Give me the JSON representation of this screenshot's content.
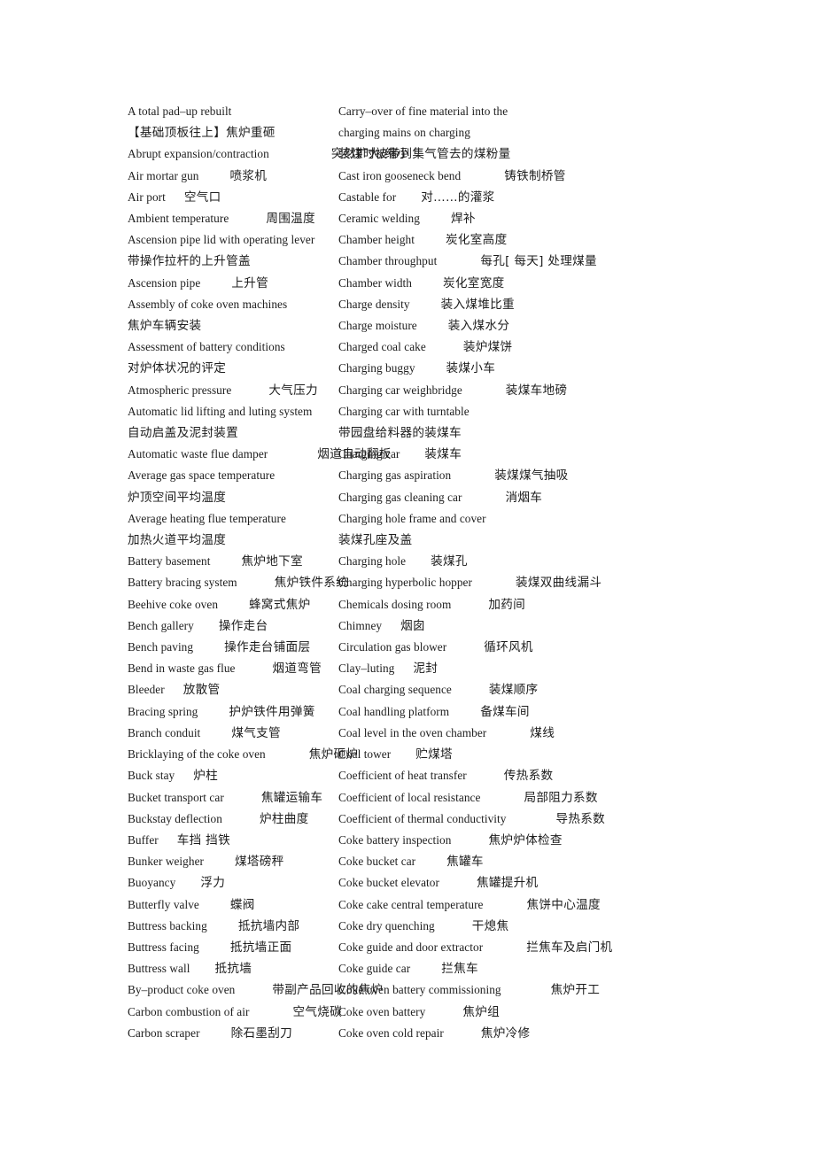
{
  "document": {
    "type": "bilingual-glossary",
    "subject": "Coke oven / coking plant terminology (English–Chinese)",
    "page_background": "#ffffff",
    "text_color": "#1d1d1d"
  },
  "columns": [
    {
      "name": "left-column",
      "entries": [
        {
          "en": "A total pad–up rebuilt",
          "zh": "",
          "gap": 0
        },
        {
          "en": "",
          "zh": "【基础顶板往上】焦炉重砸",
          "gap": 0
        },
        {
          "en": "Abrupt expansion/contraction",
          "zh": "突然扩大/缩小",
          "gap": 10
        },
        {
          "en": "Air mortar gun",
          "zh": "喷浆机",
          "gap": 5
        },
        {
          "en": "Air port",
          "zh": "空气口",
          "gap": 3
        },
        {
          "en": "Ambient temperature",
          "zh": "周围温度",
          "gap": 6
        },
        {
          "en": "Ascension pipe lid with operating lever",
          "zh": "",
          "gap": 0
        },
        {
          "en": "",
          "zh": "带操作拉杆的上升管盖",
          "gap": 0
        },
        {
          "en": "Ascension pipe",
          "zh": "上升管",
          "gap": 5
        },
        {
          "en": "Assembly of coke oven machines",
          "zh": "",
          "gap": 0
        },
        {
          "en": "",
          "zh": "焦炉车辆安装",
          "gap": 0
        },
        {
          "en": "Assessment of battery conditions",
          "zh": "",
          "gap": 0
        },
        {
          "en": "",
          "zh": "对炉体状况的评定",
          "gap": 0
        },
        {
          "en": "Atmospheric pressure",
          "zh": "大气压力",
          "gap": 6
        },
        {
          "en": "Automatic lid lifting and luting system",
          "zh": "",
          "gap": 0
        },
        {
          "en": "",
          "zh": "自动启盖及泥封装置",
          "gap": 0
        },
        {
          "en": "Automatic waste flue damper",
          "zh": "烟道自动翻板",
          "gap": 8
        },
        {
          "en": "Average gas space temperature",
          "zh": "",
          "gap": 0
        },
        {
          "en": "",
          "zh": "炉顶空间平均温度",
          "gap": 0
        },
        {
          "en": "Average heating flue temperature",
          "zh": "",
          "gap": 0
        },
        {
          "en": "",
          "zh": "加热火道平均温度",
          "gap": 0
        },
        {
          "en": "Battery basement",
          "zh": "焦炉地下室",
          "gap": 5
        },
        {
          "en": "Battery bracing system",
          "zh": "焦炉铁件系统",
          "gap": 6
        },
        {
          "en": "Beehive coke oven",
          "zh": "蜂窝式焦炉",
          "gap": 5
        },
        {
          "en": "Bench gallery",
          "zh": "操作走台",
          "gap": 4
        },
        {
          "en": "Bench paving",
          "zh": "操作走台铺面层",
          "gap": 5
        },
        {
          "en": "Bend in waste gas flue",
          "zh": "烟道弯管",
          "gap": 6
        },
        {
          "en": "Bleeder",
          "zh": "放散管",
          "gap": 3
        },
        {
          "en": "Bracing spring",
          "zh": "护炉铁件用弹簧",
          "gap": 5
        },
        {
          "en": "Branch conduit",
          "zh": "煤气支管",
          "gap": 5
        },
        {
          "en": "Bricklaying of the coke oven",
          "zh": "焦炉砸炉",
          "gap": 7
        },
        {
          "en": "Buck stay",
          "zh": "炉柱",
          "gap": 3
        },
        {
          "en": "Bucket transport car",
          "zh": "焦罐运输车",
          "gap": 6
        },
        {
          "en": "Buckstay deflection",
          "zh": "炉柱曲度",
          "gap": 6
        },
        {
          "en": "Buffer",
          "zh": "车挡 挡铁",
          "gap": 3
        },
        {
          "en": "Bunker weigher",
          "zh": "煤塔磅秤",
          "gap": 5
        },
        {
          "en": "Buoyancy",
          "zh": "浮力",
          "gap": 4
        },
        {
          "en": "Butterfly valve",
          "zh": "蝶阀",
          "gap": 5
        },
        {
          "en": "Buttress backing",
          "zh": "抵抗墙内部",
          "gap": 5
        },
        {
          "en": "Buttress facing",
          "zh": "抵抗墙正面",
          "gap": 5
        },
        {
          "en": "Buttress wall",
          "zh": "抵抗墙",
          "gap": 4
        },
        {
          "en": "By–product coke oven",
          "zh": "带副产品回收的焦炉",
          "gap": 6
        },
        {
          "en": "Carbon combustion of air",
          "zh": "空气烧碳",
          "gap": 7
        },
        {
          "en": "Carbon scraper",
          "zh": "除石墨刮刀",
          "gap": 5
        }
      ]
    },
    {
      "name": "right-column",
      "entries": [
        {
          "en": "Carry–over of fine material into the",
          "zh": "",
          "gap": 0
        },
        {
          "en": "charging mains on charging",
          "zh": "",
          "gap": 0
        },
        {
          "en": "",
          "zh": "装煤时被带到集气管去的煤粉量",
          "gap": 0
        },
        {
          "en": "Cast iron gooseneck bend",
          "zh": "铸铁制桥管",
          "gap": 7
        },
        {
          "en": "Castable for",
          "zh": "对……的灌浆",
          "gap": 4
        },
        {
          "en": "Ceramic welding",
          "zh": "焊补",
          "gap": 5
        },
        {
          "en": "Chamber height",
          "zh": "炭化室高度",
          "gap": 5
        },
        {
          "en": "Chamber throughput",
          "zh": "每孔[ 每天] 处理煤量",
          "gap": 7
        },
        {
          "en": "Chamber width",
          "zh": "炭化室宽度",
          "gap": 5
        },
        {
          "en": "Charge density",
          "zh": "装入煤堆比重",
          "gap": 5
        },
        {
          "en": "Charge moisture",
          "zh": "装入煤水分",
          "gap": 5
        },
        {
          "en": "Charged coal cake",
          "zh": "装炉煤饼",
          "gap": 6
        },
        {
          "en": "Charging buggy",
          "zh": "装煤小车",
          "gap": 5
        },
        {
          "en": "Charging car weighbridge",
          "zh": "装煤车地磅",
          "gap": 7
        },
        {
          "en": "Charging car with turntable",
          "zh": "",
          "gap": 0
        },
        {
          "en": "",
          "zh": "带园盘给料器的装煤车",
          "gap": 0
        },
        {
          "en": "Charging car",
          "zh": "装煤车",
          "gap": 4
        },
        {
          "en": "Charging gas aspiration",
          "zh": "装煤煤气抽吸",
          "gap": 7
        },
        {
          "en": "Charging gas cleaning car",
          "zh": "消烟车",
          "gap": 7
        },
        {
          "en": "Charging hole frame and cover",
          "zh": "",
          "gap": 0
        },
        {
          "en": "",
          "zh": "装煤孔座及盖",
          "gap": 0
        },
        {
          "en": "Charging hole",
          "zh": "装煤孔",
          "gap": 4
        },
        {
          "en": "Charging hyperbolic hopper",
          "zh": "装煤双曲线漏斗",
          "gap": 7
        },
        {
          "en": "Chemicals dosing room",
          "zh": "加药间",
          "gap": 6
        },
        {
          "en": "Chimney",
          "zh": "烟囱",
          "gap": 3
        },
        {
          "en": "Circulation gas blower",
          "zh": "循环风机",
          "gap": 6
        },
        {
          "en": "Clay–luting",
          "zh": "泥封",
          "gap": 3
        },
        {
          "en": "Coal charging sequence",
          "zh": "装煤顺序",
          "gap": 6
        },
        {
          "en": "Coal handling platform",
          "zh": "备煤车间",
          "gap": 5
        },
        {
          "en": "Coal level in the oven chamber",
          "zh": "煤线",
          "gap": 7
        },
        {
          "en": "Coal tower",
          "zh": "贮煤塔",
          "gap": 4
        },
        {
          "en": "Coefficient of heat transfer",
          "zh": "传热系数",
          "gap": 6
        },
        {
          "en": "Coefficient of local resistance",
          "zh": "局部阻力系数",
          "gap": 7
        },
        {
          "en": "Coefficient of thermal conductivity",
          "zh": "导热系数",
          "gap": 8
        },
        {
          "en": "Coke battery inspection",
          "zh": "焦炉炉体检查",
          "gap": 6
        },
        {
          "en": "Coke bucket car",
          "zh": "焦罐车",
          "gap": 5
        },
        {
          "en": "Coke bucket elevator",
          "zh": "焦罐提升机",
          "gap": 6
        },
        {
          "en": "Coke cake central temperature",
          "zh": "焦饼中心温度",
          "gap": 7
        },
        {
          "en": "Coke dry quenching",
          "zh": "干熄焦",
          "gap": 6
        },
        {
          "en": "Coke guide and door extractor",
          "zh": "拦焦车及启门机",
          "gap": 7
        },
        {
          "en": "Coke guide car",
          "zh": "拦焦车",
          "gap": 5
        },
        {
          "en": "Coke oven battery commissioning",
          "zh": "焦炉开工",
          "gap": 8
        },
        {
          "en": "Coke oven battery",
          "zh": "焦炉组",
          "gap": 6
        },
        {
          "en": "Coke oven cold repair",
          "zh": "焦炉冷修",
          "gap": 6
        }
      ]
    }
  ]
}
